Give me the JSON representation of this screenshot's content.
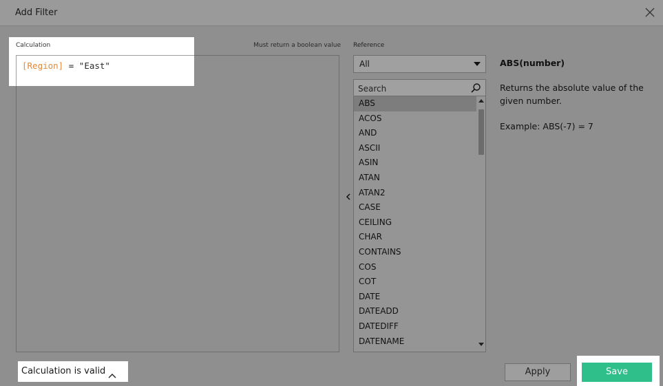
{
  "dialog": {
    "title": "Add Filter"
  },
  "calculation": {
    "label": "Calculation",
    "hint": "Must return a boolean value",
    "code_field": "[Region]",
    "code_operator": " = ",
    "code_value": "\"East\""
  },
  "reference": {
    "label": "Reference",
    "category_selected": "All",
    "search_placeholder": "Search",
    "functions": [
      "ABS",
      "ACOS",
      "AND",
      "ASCII",
      "ASIN",
      "ATAN",
      "ATAN2",
      "CASE",
      "CEILING",
      "CHAR",
      "CONTAINS",
      "COS",
      "COT",
      "DATE",
      "DATEADD",
      "DATEDIFF",
      "DATENAME"
    ],
    "selected_function": "ABS"
  },
  "help": {
    "title": "ABS(number)",
    "description": "Returns the absolute value of the given number.",
    "example": "Example: ABS(-7) = 7"
  },
  "footer": {
    "status": "Calculation is valid",
    "apply_label": "Apply",
    "save_label": "Save"
  },
  "colors": {
    "field": "#e08a3c",
    "save": "#2fbf8b"
  }
}
